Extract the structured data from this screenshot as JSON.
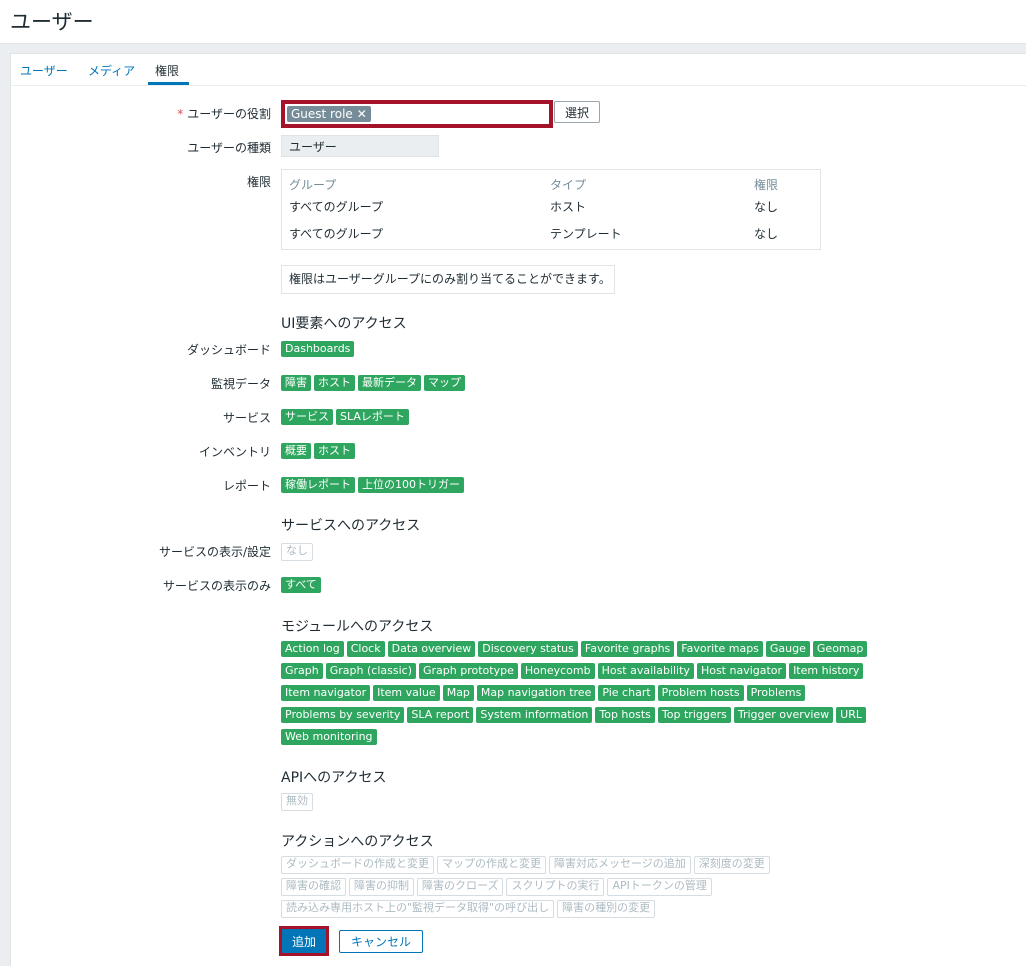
{
  "page": {
    "title": "ユーザー"
  },
  "tabs": [
    {
      "label": "ユーザー"
    },
    {
      "label": "メディア"
    },
    {
      "label": "権限"
    }
  ],
  "form": {
    "role_label": "ユーザーの役割",
    "role_chip": "Guest role",
    "select_button": "選択",
    "user_type_label": "ユーザーの種類",
    "user_type_value": "ユーザー",
    "permissions_label": "権限",
    "permissions_table": {
      "headers": [
        "グループ",
        "タイプ",
        "権限"
      ],
      "rows": [
        [
          "すべてのグループ",
          "ホスト",
          "なし"
        ],
        [
          "すべてのグループ",
          "テンプレート",
          "なし"
        ]
      ]
    },
    "permissions_info": "権限はユーザーグループにのみ割り当てることができます。"
  },
  "ui_access": {
    "title": "UI要素へのアクセス",
    "rows": [
      {
        "label": "ダッシュボード",
        "tags": [
          "Dashboards"
        ]
      },
      {
        "label": "監視データ",
        "tags": [
          "障害",
          "ホスト",
          "最新データ",
          "マップ"
        ]
      },
      {
        "label": "サービス",
        "tags": [
          "サービス",
          "SLAレポート"
        ]
      },
      {
        "label": "インベントリ",
        "tags": [
          "概要",
          "ホスト"
        ]
      },
      {
        "label": "レポート",
        "tags": [
          "稼働レポート",
          "上位の100トリガー"
        ]
      }
    ]
  },
  "service_access": {
    "title": "サービスへのアクセス",
    "read_write_label": "サービスの表示/設定",
    "read_write_value": "なし",
    "read_only_label": "サービスの表示のみ",
    "read_only_value": "すべて"
  },
  "module_access": {
    "title": "モジュールへのアクセス",
    "rows": [
      [
        "Action log",
        "Clock",
        "Data overview",
        "Discovery status",
        "Favorite graphs",
        "Favorite maps",
        "Gauge",
        "Geomap"
      ],
      [
        "Graph",
        "Graph (classic)",
        "Graph prototype",
        "Honeycomb",
        "Host availability",
        "Host navigator",
        "Item history"
      ],
      [
        "Item navigator",
        "Item value",
        "Map",
        "Map navigation tree",
        "Pie chart",
        "Problem hosts",
        "Problems"
      ],
      [
        "Problems by severity",
        "SLA report",
        "System information",
        "Top hosts",
        "Top triggers",
        "Trigger overview",
        "URL"
      ],
      [
        "Web monitoring"
      ]
    ]
  },
  "api_access": {
    "title": "APIへのアクセス",
    "value": "無効"
  },
  "action_access": {
    "title": "アクションへのアクセス",
    "rows": [
      [
        "ダッシュボードの作成と変更",
        "マップの作成と変更",
        "障害対応メッセージの追加",
        "深刻度の変更"
      ],
      [
        "障害の確認",
        "障害の抑制",
        "障害のクローズ",
        "スクリプトの実行",
        "APIトークンの管理"
      ],
      [
        "読み込み専用ホスト上の\"監視データ取得\"の呼び出し",
        "障害の種別の変更"
      ]
    ]
  },
  "buttons": {
    "add": "追加",
    "cancel": "キャンセル"
  },
  "colors": {
    "accent": "#0275b8",
    "tag_enabled": "#2fa65f",
    "highlight": "#a5132b"
  }
}
